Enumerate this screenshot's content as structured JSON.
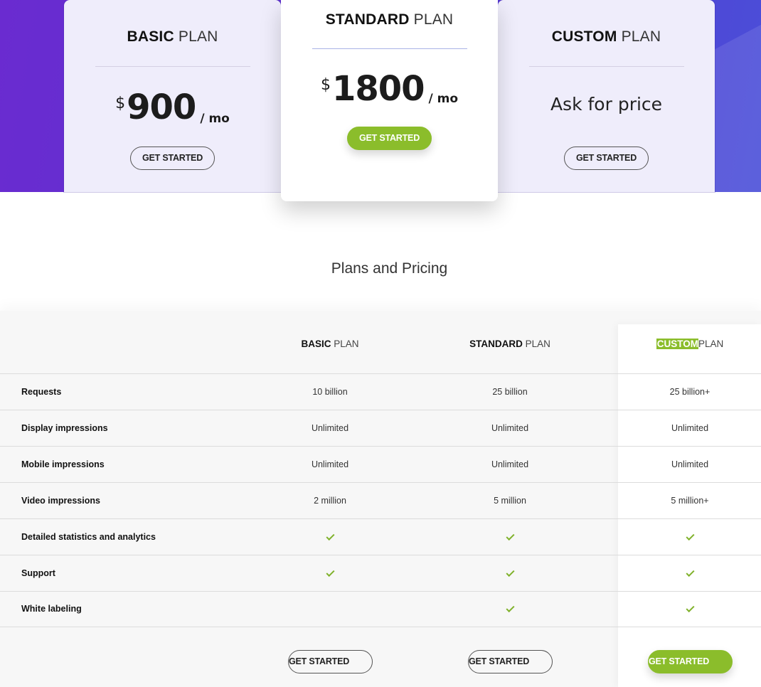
{
  "hero": {
    "plans": [
      {
        "name_bold": "BASIC",
        "name_light": "PLAN",
        "currency": "$",
        "amount": "900",
        "period": "/ mo",
        "cta": "GET STARTED"
      },
      {
        "name_bold": "STANDARD",
        "name_light": "PLAN",
        "currency": "$",
        "amount": "1800",
        "period": "/ mo",
        "cta": "GET STARTED"
      },
      {
        "name_bold": "CUSTOM",
        "name_light": "PLAN",
        "price_text": "Ask for price",
        "cta": "GET STARTED"
      }
    ]
  },
  "section_title": "Plans and Pricing",
  "table": {
    "columns": [
      {
        "bold": "BASIC",
        "light": "PLAN"
      },
      {
        "bold": "STANDARD",
        "light": "PLAN"
      },
      {
        "bold": "CUSTOM",
        "light": "PLAN"
      }
    ],
    "rows": [
      {
        "label": "Requests",
        "values": [
          "10 billion",
          "25 billion",
          "25 billion+"
        ]
      },
      {
        "label": "Display impressions",
        "values": [
          "Unlimited",
          "Unlimited",
          "Unlimited"
        ]
      },
      {
        "label": "Mobile impressions",
        "values": [
          "Unlimited",
          "Unlimited",
          "Unlimited"
        ]
      },
      {
        "label": "Video impressions",
        "values": [
          "2 million",
          "5 million",
          "5 million+"
        ]
      },
      {
        "label": "Detailed statistics and analytics",
        "checks": [
          true,
          true,
          true
        ]
      },
      {
        "label": "Support",
        "checks": [
          true,
          true,
          true
        ]
      },
      {
        "label": "White labeling",
        "checks": [
          false,
          true,
          true
        ]
      }
    ],
    "cta": [
      "GET STARTED",
      "GET STARTED",
      "GET STARTED"
    ]
  },
  "colors": {
    "accent_green": "#8bbd2b",
    "hero_purple": "#5a35d2"
  },
  "icons": {
    "check": "check-icon"
  }
}
